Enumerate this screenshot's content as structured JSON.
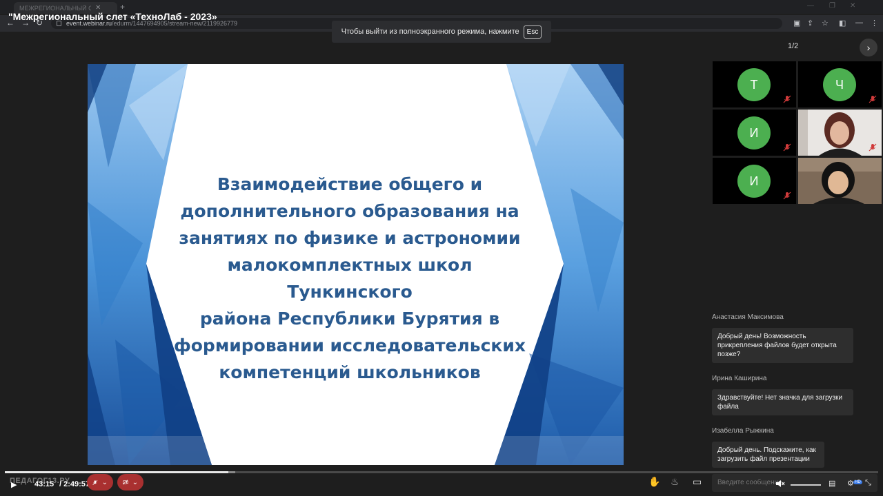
{
  "browser": {
    "tab_label": "МЕЖРЕГИОНАЛЬНЫЙ СЛЕТ",
    "url_host": "event.webinar.ru",
    "url_path": "/edurm/1447694905/stream-new/2119926779"
  },
  "event": {
    "title": "\"Межрегиональный слет «ТехноЛаб - 2023»"
  },
  "fullscreen_notice": {
    "text": "Чтобы выйти из полноэкранного режима, нажмите",
    "key": "Esc"
  },
  "slide": {
    "lines": [
      "Взаимодействие общего и",
      "дополнительного образования на",
      "занятиях по физике и астрономии",
      "малокомплектных школ Тункинского",
      "района Республики Бурятия в",
      "формировании исследовательских",
      "компетенций школьников"
    ]
  },
  "participants": {
    "pager": "1/2",
    "tiles": [
      {
        "initial": "Т",
        "type": "avatar",
        "muted": true
      },
      {
        "initial": "Ч",
        "type": "avatar",
        "muted": true
      },
      {
        "initial": "И",
        "type": "avatar",
        "muted": true
      },
      {
        "initial": "",
        "type": "video",
        "muted": true
      },
      {
        "initial": "И",
        "type": "avatar",
        "muted": true
      },
      {
        "initial": "",
        "type": "video",
        "muted": false
      }
    ],
    "avatar_color": "#4caf50"
  },
  "chat": {
    "messages": [
      {
        "author": "Анастасия Максимова",
        "text": "Добрый день! Возможность прикрепления файлов будет открыта позже?"
      },
      {
        "author": "Ирина Каширина",
        "text": "Здравствуйте!  Нет значка для  загрузки файла"
      },
      {
        "author": "Изабелла Рыжкина",
        "text": "Добрый день. Подскажите, как загрузить файл презентации"
      }
    ],
    "input_placeholder": "Введите сообщение"
  },
  "player": {
    "brand": "ПЕДАГОГ13.РУ",
    "current_time": "43:15",
    "total_time": "/ 2:49:57",
    "progress": 0.2559,
    "buffered": 0.264,
    "hd_badge": "HD"
  },
  "colors": {
    "slide_text": "#2a5a8f",
    "mute_pill": "#a93030",
    "accent_blue": "#3b7be8"
  }
}
